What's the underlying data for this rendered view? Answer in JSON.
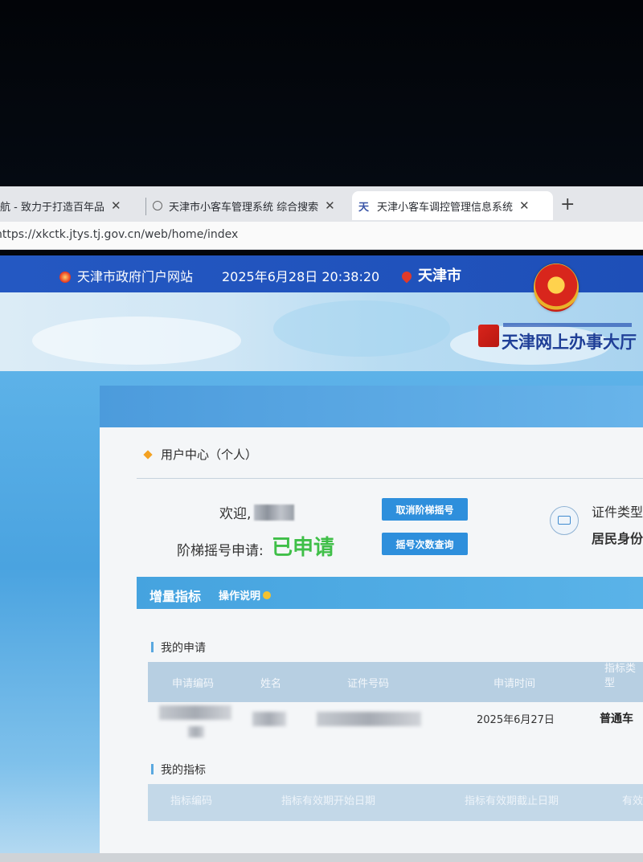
{
  "browser": {
    "tabs": [
      {
        "title": "航 - 致力于打造百年品",
        "close": "✕"
      },
      {
        "title": "天津市小客车管理系统 综合搜索",
        "close": "✕"
      },
      {
        "title": "天津小客车调控管理信息系统",
        "close": "✕",
        "icon_text": "天"
      }
    ],
    "new_tab": "+",
    "url": "https://xkctk.jtys.tj.gov.cn/web/home/index"
  },
  "header": {
    "portal_link": "天津市政府门户网站",
    "datetime": "2025年6月28日 20:38:20",
    "city": "天津市",
    "hall_title": "天津网上办事大厅"
  },
  "user_center": {
    "title": "用户中心（个人）",
    "welcome_label": "欢迎,",
    "apply_label": "阶梯摇号申请:",
    "apply_status": "已申请",
    "cancel_button": "取消阶梯摇号",
    "query_button": "摇号次数查询",
    "id_type_label": "证件类型",
    "id_type_value": "居民身份"
  },
  "section": {
    "title": "增量指标",
    "help": "操作说明"
  },
  "my_applications": {
    "title": "我的申请",
    "columns": [
      "申请编码",
      "姓名",
      "证件号码",
      "申请时间",
      "指标类型"
    ],
    "rows": [
      {
        "date": "2025年6月27日",
        "type": "普通车"
      }
    ]
  },
  "my_quota": {
    "title": "我的指标",
    "columns": [
      "指标编码",
      "指标有效期开始日期",
      "指标有效期截止日期",
      "有效"
    ]
  },
  "colors": {
    "header_blue": "#2458c2",
    "button_blue": "#2e8fdc",
    "status_green": "#3fbf48",
    "section_blue": "#45a3df"
  }
}
